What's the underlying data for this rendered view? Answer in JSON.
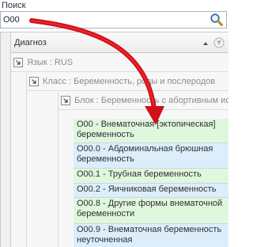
{
  "search": {
    "label": "Поиск",
    "value": "O00"
  },
  "grid": {
    "header_title": "Диагноз",
    "groups": [
      {
        "label": "Язык : RUS"
      },
      {
        "label": "Класс : Беременность, роды и послеродов"
      },
      {
        "label": "Блок : Беременность с абортивным ис"
      }
    ],
    "rows": [
      {
        "text": "O00 - Внематочная [эктопическая] беременность",
        "color": "green"
      },
      {
        "text": "O00.0 - Абдоминальная  брюшная беременность",
        "color": "blue"
      },
      {
        "text": "O00.1 - Трубная беременность",
        "color": "green"
      },
      {
        "text": "O00.2 - Яичниковая беременность",
        "color": "blue"
      },
      {
        "text": "O00.8 - Другие формы внематочной беременности",
        "color": "green"
      },
      {
        "text": "O00.9 - Внематочная беременность неуточненная",
        "color": "blue"
      }
    ]
  },
  "colors": {
    "arrow": "#e8121b",
    "row_green": "#dff7dc",
    "row_blue": "#dceefc"
  }
}
